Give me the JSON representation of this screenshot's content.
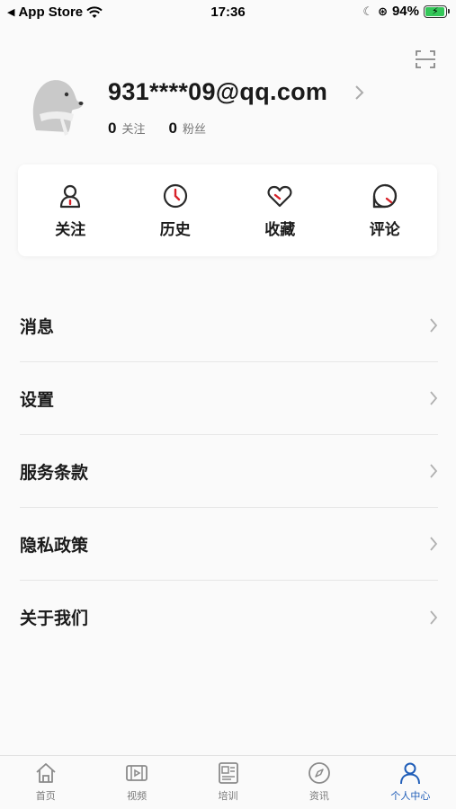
{
  "status_bar": {
    "back_app": "App Store",
    "time": "17:36",
    "battery": "94%"
  },
  "profile": {
    "username": "931****09@qq.com",
    "following_count": "0",
    "following_label": "关注",
    "fans_count": "0",
    "fans_label": "粉丝"
  },
  "actions": [
    {
      "label": "关注",
      "icon": "user-icon"
    },
    {
      "label": "历史",
      "icon": "clock-icon"
    },
    {
      "label": "收藏",
      "icon": "heart-icon"
    },
    {
      "label": "评论",
      "icon": "comment-icon"
    }
  ],
  "menu": [
    {
      "label": "消息"
    },
    {
      "label": "设置"
    },
    {
      "label": "服务条款"
    },
    {
      "label": "隐私政策"
    },
    {
      "label": "关于我们"
    }
  ],
  "tabs": [
    {
      "label": "首页",
      "icon": "home-icon",
      "active": false
    },
    {
      "label": "视频",
      "icon": "video-icon",
      "active": false
    },
    {
      "label": "培训",
      "icon": "training-icon",
      "active": false
    },
    {
      "label": "资讯",
      "icon": "compass-icon",
      "active": false
    },
    {
      "label": "个人中心",
      "icon": "person-icon",
      "active": true
    }
  ],
  "colors": {
    "accent": "#1f5db8",
    "icon_red": "#d8222a",
    "icon_dark": "#2a2a2a",
    "battery_green": "#34c759"
  }
}
